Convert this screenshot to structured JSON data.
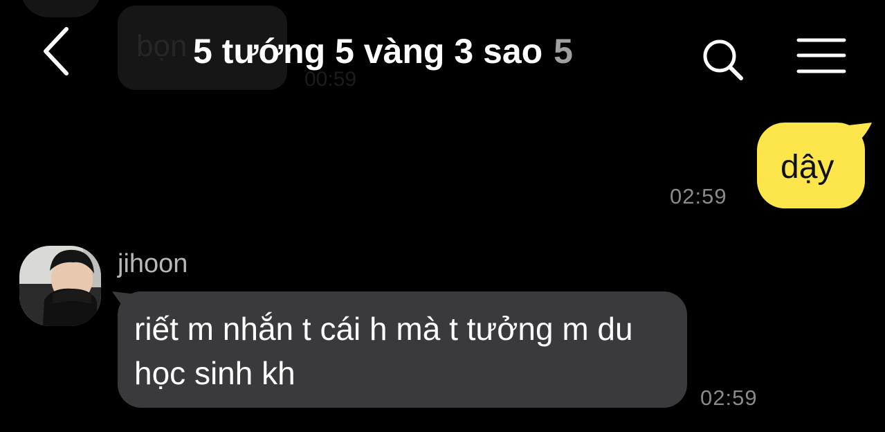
{
  "header": {
    "title": "5 tướng 5 vàng 3 sao",
    "member_count": "5",
    "back_icon": "chevron-left-icon",
    "search_icon": "search-icon",
    "menu_icon": "hamburger-menu-icon"
  },
  "partial_message": {
    "text": "bọn",
    "time": "00:59"
  },
  "messages": [
    {
      "direction": "outgoing",
      "text": "dậy",
      "time": "02:59"
    },
    {
      "direction": "incoming",
      "sender": "jihoon",
      "text": "riết m nhắn t cái h mà t tưởng m du học sinh kh",
      "time": "02:59"
    }
  ],
  "colors": {
    "background": "#000000",
    "outgoing_bubble": "#fde64b",
    "incoming_bubble": "#3a3a3c",
    "timestamp": "#8a8a8a",
    "member_count": "#a0a0a0"
  }
}
